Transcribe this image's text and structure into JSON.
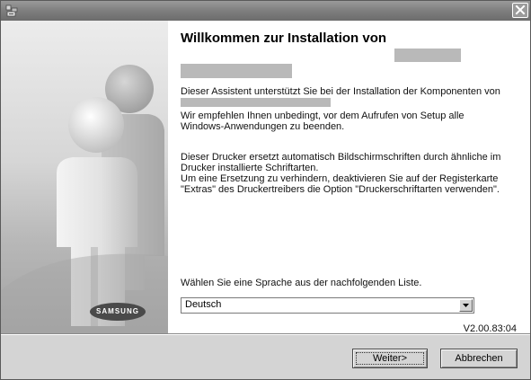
{
  "window": {
    "title_icon": "installer-app-icon",
    "close_icon": "close-icon"
  },
  "banner": {
    "brand": "SAMSUNG",
    "illustration": "people-silhouettes"
  },
  "content": {
    "heading": "Willkommen zur Installation von",
    "paragraphs": {
      "p1": "Dieser Assistent unterstützt Sie bei der Installation der Komponenten von",
      "p2_line1": "Wir empfehlen Ihnen unbedingt, vor dem Aufrufen von Setup alle",
      "p2_line2": "Windows-Anwendungen zu beenden.",
      "p3_line1": "Dieser Drucker ersetzt automatisch Bildschirmschriften durch ähnliche im",
      "p3_line2": "Drucker installierte Schriftarten.",
      "p3_line3": "Um eine Ersetzung zu verhindern, deaktivieren Sie auf der Registerkarte",
      "p3_line4": "\"Extras\" des Druckertreibers die Option \"Druckerschriftarten verwenden\"."
    },
    "language_label": "Wählen Sie eine Sprache aus der nachfolgenden Liste.",
    "language_select": {
      "value": "Deutsch",
      "icon": "chevron-down-icon"
    },
    "version": "V2.00.83:04"
  },
  "buttons": {
    "next": "Weiter>",
    "cancel": "Abbrechen"
  },
  "colors": {
    "titlebar": "#7e7e7e",
    "dialog_bg": "#d4d4d4",
    "content_bg": "#ffffff",
    "redaction": "#b9b9b9"
  }
}
